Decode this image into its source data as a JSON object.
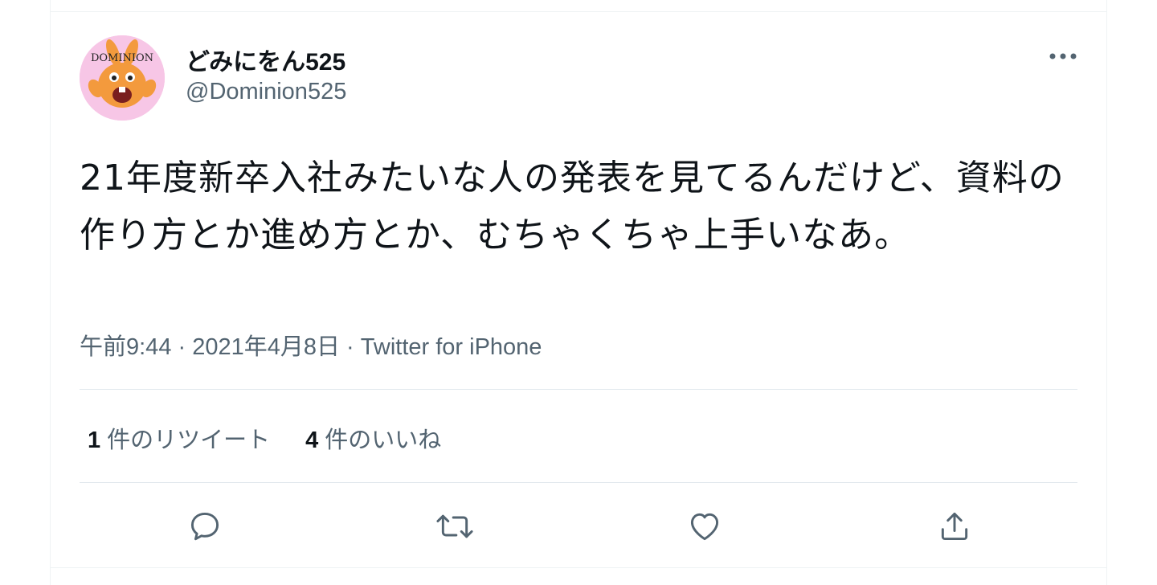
{
  "tweet": {
    "author": {
      "display_name": "どみにをん525",
      "handle": "@Dominion525",
      "avatar_text": "DOMINION"
    },
    "text": "21年度新卒入社みたいな人の発表を見てるんだけど、資料の作り方とか進め方とか、むちゃくちゃ上手いなあ。",
    "timestamp": "午前9:44 · 2021年4月8日",
    "separator": " · ",
    "source": "Twitter for iPhone",
    "stats": {
      "retweets_count": "1",
      "retweets_label": "件のリツイート",
      "likes_count": "4",
      "likes_label": "件のいいね"
    }
  },
  "icons": {
    "more": "more-horizontal-icon",
    "reply": "reply-icon",
    "retweet": "retweet-icon",
    "like": "heart-icon",
    "share": "share-icon"
  },
  "colors": {
    "text_primary": "#0f1419",
    "text_secondary": "#536471",
    "divider": "#e1e8ed",
    "avatar_bg": "#f7c6e6"
  }
}
